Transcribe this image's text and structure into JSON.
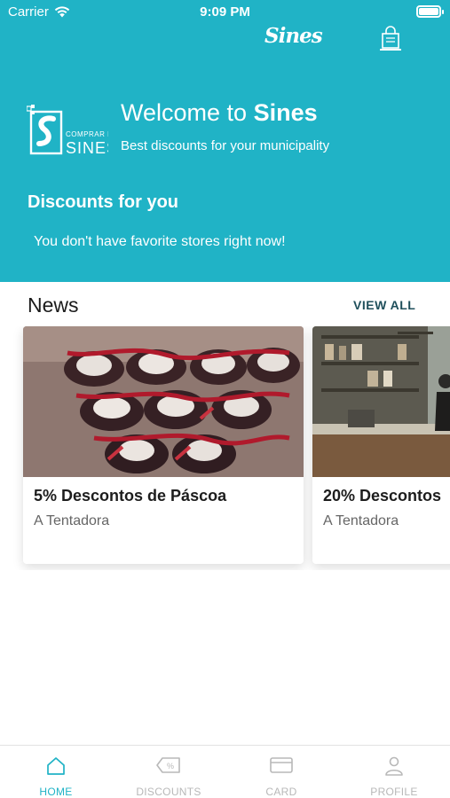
{
  "colors": {
    "accent": "#20b3c6",
    "header_bg": "#20b3c6",
    "inactive": "#b8b8b8",
    "link": "#1f4f5b"
  },
  "status_bar": {
    "carrier": "Carrier",
    "time": "9:09 PM"
  },
  "header": {
    "brand": "Sines",
    "muni_logo_text": [
      "COMPRAR EM",
      "SINES"
    ],
    "welcome_prefix": "Welcome to ",
    "welcome_name": "Sines",
    "tagline": "Best discounts for your municipality",
    "discounts_title": "Discounts for you",
    "empty_message": "You don't have favorite stores right now!"
  },
  "news": {
    "title": "News",
    "view_all": "VIEW ALL",
    "items": [
      {
        "title": "5% Descontos de Páscoa",
        "store": "A Tentadora",
        "image": "easter-chocolates-photo"
      },
      {
        "title": "20% Descontos",
        "store": "A Tentadora",
        "image": "shop-interior-photo"
      }
    ]
  },
  "tabs": [
    {
      "label": "HOME",
      "icon": "home-icon",
      "active": true
    },
    {
      "label": "DISCOUNTS",
      "icon": "discount-tag-icon",
      "active": false
    },
    {
      "label": "CARD",
      "icon": "card-icon",
      "active": false
    },
    {
      "label": "PROFILE",
      "icon": "profile-icon",
      "active": false
    }
  ]
}
